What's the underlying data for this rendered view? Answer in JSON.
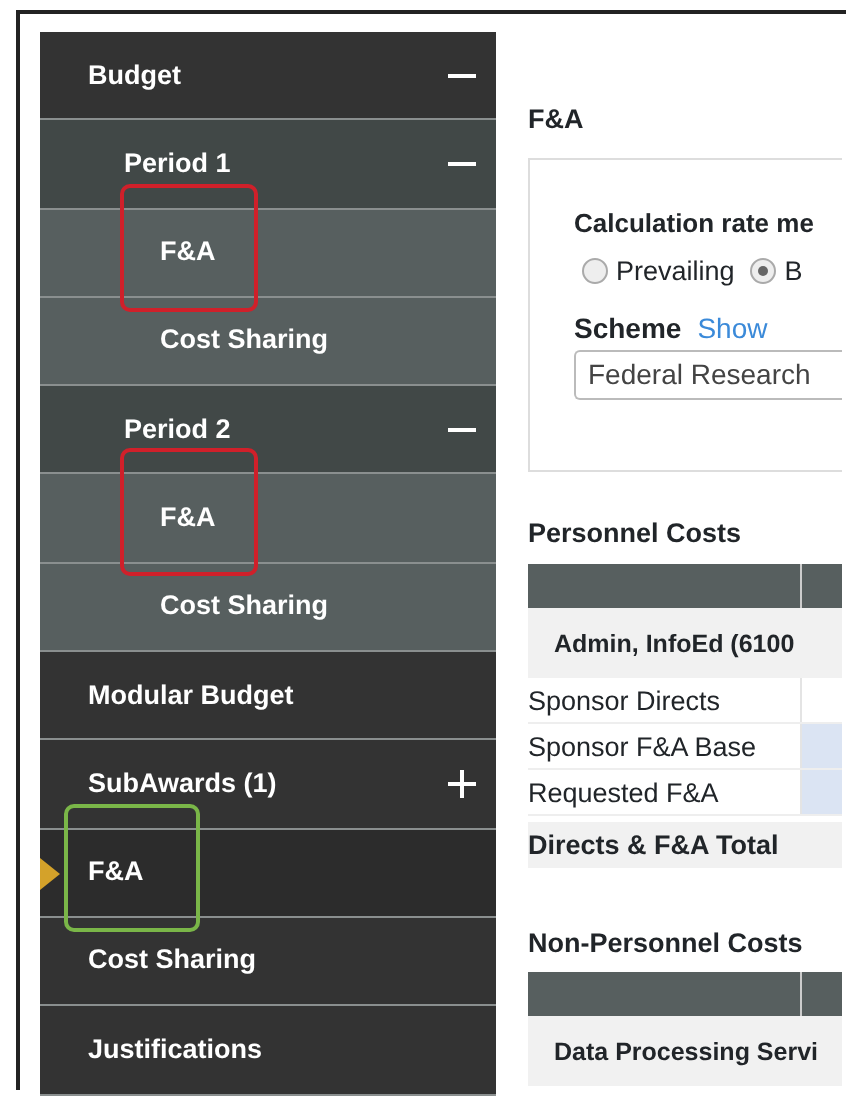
{
  "sidebar": {
    "items": [
      {
        "label": "Budget",
        "expanded": true,
        "selected": false,
        "children": [
          {
            "label": "Period 1",
            "expanded": true,
            "selected": false,
            "children": [
              {
                "label": "F&A",
                "selected": false,
                "color": "#d0202a"
              },
              {
                "label": "Cost Sharing",
                "selected": false
              }
            ]
          },
          {
            "label": "Period 2",
            "expanded": true,
            "selected": false,
            "children": [
              {
                "label": "F&A",
                "selected": false,
                "color": "#d0202a"
              },
              {
                "label": "Cost Sharing",
                "selected": false
              }
            ]
          }
        ]
      },
      {
        "label": "Modular Budget",
        "selected": false
      },
      {
        "label": "SubAwards (1)",
        "expanded": false,
        "selected": false
      },
      {
        "label": "F&A",
        "selected": true,
        "color": "#7ab648"
      },
      {
        "label": "Cost Sharing",
        "selected": false
      },
      {
        "label": "Justifications",
        "selected": false
      }
    ]
  },
  "content": {
    "title": "F&A",
    "rate_panel": {
      "label": "Calculation rate me",
      "options": [
        {
          "label": "Prevailing",
          "selected": false
        },
        {
          "label": "B",
          "selected": true
        }
      ],
      "scheme_label": "Scheme",
      "scheme_link": "Show",
      "scheme_value": "Federal Research"
    },
    "sections": [
      {
        "title": "Personnel Costs",
        "group": "Admin, InfoEd (6100",
        "rows": [
          {
            "label": "Sponsor Directs",
            "editable": false
          },
          {
            "label": "Sponsor F&A Base",
            "editable": true
          },
          {
            "label": "Requested F&A",
            "editable": true
          }
        ],
        "total": "Directs & F&A Total"
      },
      {
        "title": "Non-Personnel Costs",
        "group": "Data Processing Servi"
      }
    ]
  }
}
